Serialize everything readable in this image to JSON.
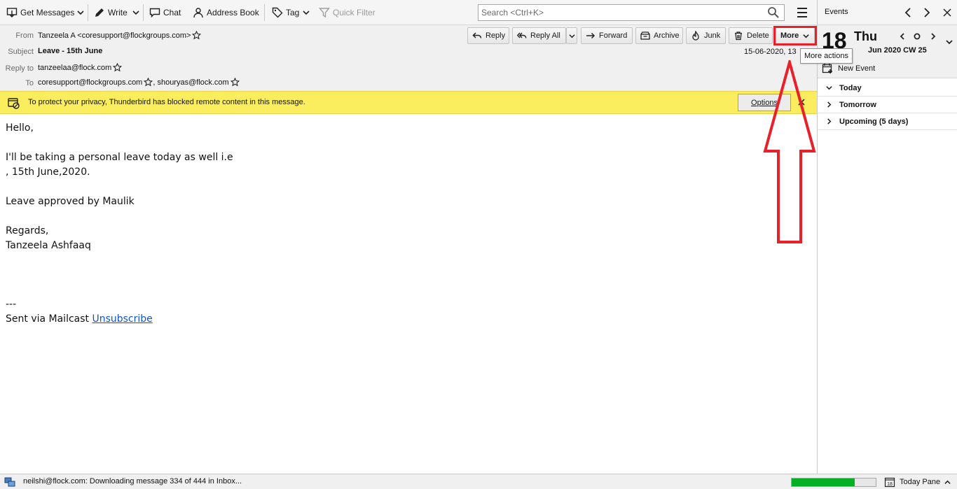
{
  "toolbar": {
    "get_messages": "Get Messages",
    "write": "Write",
    "chat": "Chat",
    "address_book": "Address Book",
    "tag": "Tag",
    "quick_filter": "Quick Filter",
    "search_placeholder": "Search <Ctrl+K>"
  },
  "header": {
    "from_label": "From",
    "from_value": "Tanzeela A <coresupport@flockgroups.com>",
    "subject_label": "Subject",
    "subject_value": "Leave - 15th June",
    "reply_to_label": "Reply to",
    "reply_to_value": "tanzeelaa@flock.com",
    "to_label": "To",
    "to_value_1": "coresupport@flockgroups.com",
    "to_value_2": ", shouryas@flock.com",
    "date": "15-06-2020, 13",
    "actions": {
      "reply": "Reply",
      "reply_all": "Reply All",
      "forward": "Forward",
      "archive": "Archive",
      "junk": "Junk",
      "delete": "Delete",
      "more": "More"
    },
    "tooltip": "More actions"
  },
  "notification": {
    "text": "To protect your privacy, Thunderbird has blocked remote content in this message.",
    "options": "Options"
  },
  "body": {
    "greeting": "Hello,",
    "line1": "I'll be taking a personal leave today as well i.e",
    "line2": ", 15th June,2020.",
    "line3": "Leave approved by Maulik",
    "regards": "Regards,",
    "signature": "Tanzeela Ashfaaq",
    "separator": "---",
    "footer_prefix": "Sent via Mailcast ",
    "unsubscribe": "Unsubscribe"
  },
  "today_pane": {
    "title": "Events",
    "day_number": "18",
    "day_name": "Thu",
    "month_line": "Jun 2020  CW 25",
    "new_event": "New Event",
    "groups": [
      "Today",
      "Tomorrow",
      "Upcoming (5 days)"
    ]
  },
  "status": {
    "text": "neilshi@flock.com: Downloading message 334 of 444 in Inbox...",
    "progress_fraction": 0.75,
    "today_pane_label": "Today Pane",
    "calendar_icon_day": "18"
  },
  "colors": {
    "highlight": "#e8202a",
    "notification_bg": "#fbee5e",
    "progress": "#06b025",
    "link": "#1155cc"
  }
}
